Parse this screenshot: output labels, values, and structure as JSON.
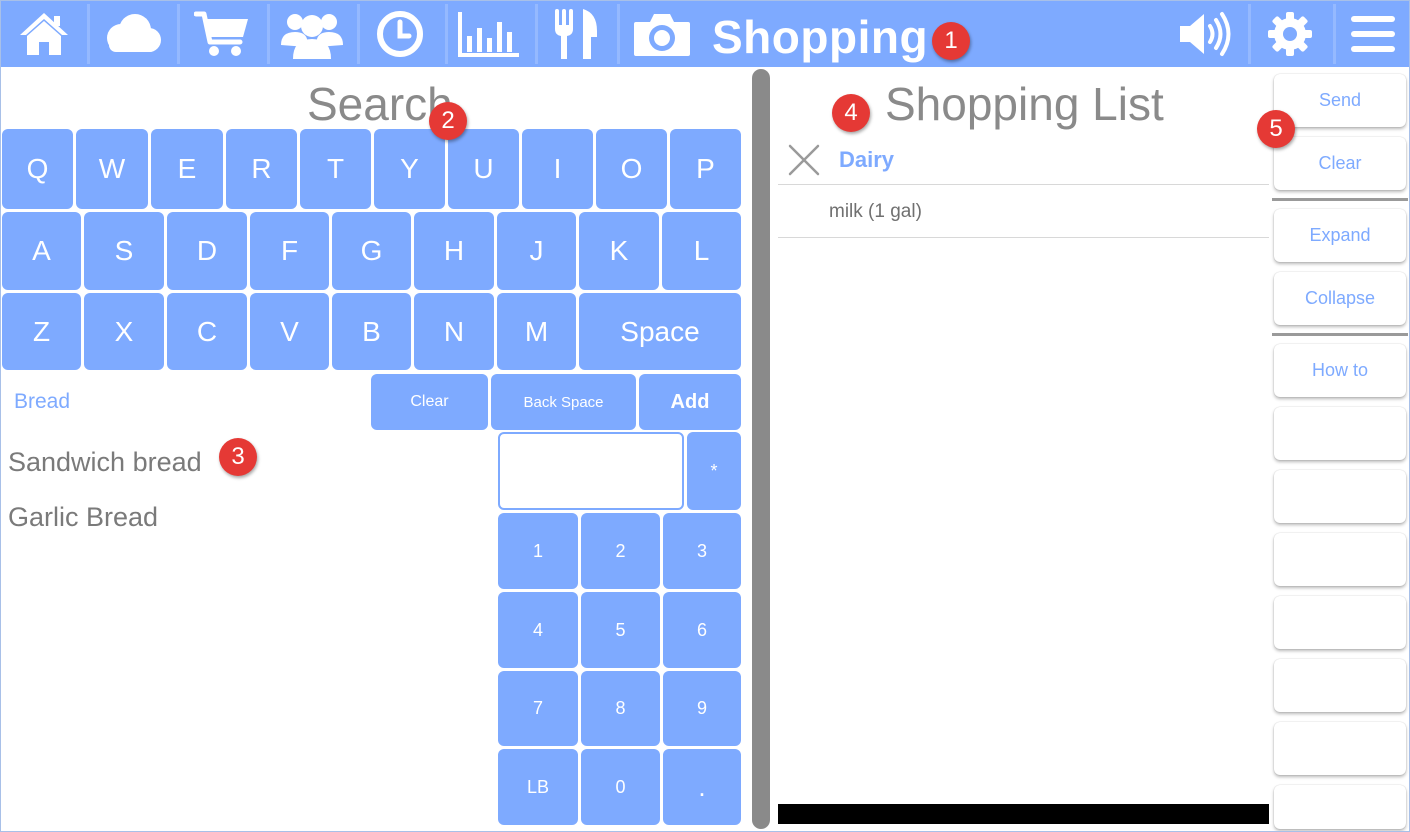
{
  "header": {
    "title": "Shopping",
    "icons": [
      "home-icon",
      "cloud-icon",
      "cart-icon",
      "group-icon",
      "clock-icon",
      "bar-chart-icon",
      "utensils-icon",
      "camera-icon",
      "speaker-icon",
      "gear-icon",
      "menu-icon"
    ],
    "color": "#7eaaff"
  },
  "badges": [
    "1",
    "2",
    "3",
    "4",
    "5"
  ],
  "search": {
    "title": "Search",
    "keyboard": {
      "row1": [
        "Q",
        "W",
        "E",
        "R",
        "T",
        "Y",
        "U",
        "I",
        "O",
        "P"
      ],
      "row2": [
        "A",
        "S",
        "D",
        "F",
        "G",
        "H",
        "J",
        "K",
        "L"
      ],
      "row3": [
        "Z",
        "X",
        "C",
        "V",
        "B",
        "N",
        "M"
      ],
      "space": "Space"
    },
    "category": "Bread",
    "clear_label": "Clear",
    "backspace_label": "Back Space",
    "add_label": "Add",
    "results": [
      "Sandwich bread",
      "Garlic Bread"
    ],
    "quantity_value": "",
    "numpad": {
      "star": "*",
      "keys": [
        "1",
        "2",
        "3",
        "4",
        "5",
        "6",
        "7",
        "8",
        "9",
        "LB",
        "0",
        "."
      ]
    }
  },
  "shopping_list": {
    "title": "Shopping List",
    "category": "Dairy",
    "items": [
      "milk (1 gal)"
    ]
  },
  "side_buttons": {
    "send": "Send",
    "clear": "Clear",
    "expand": "Expand",
    "collapse": "Collapse",
    "how_to": "How to"
  }
}
